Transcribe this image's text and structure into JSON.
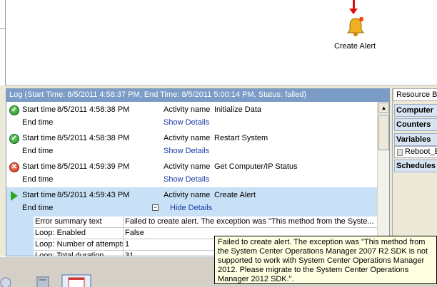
{
  "canvas": {
    "activity_label": "Create Alert",
    "activity_icon": "bell-alert-icon"
  },
  "log": {
    "header": "Log  (Start Time: 8/5/2011 4:58:37 PM, End Time: 8/5/2011 5:00:14 PM, Status: failed)",
    "start_label": "Start time",
    "end_label": "End time",
    "activity_label": "Activity name",
    "entries": [
      {
        "start": "8/5/2011 4:58:38 PM",
        "activity": "Initialize Data",
        "link": "Show Details",
        "status": "success"
      },
      {
        "start": "8/5/2011 4:58:38 PM",
        "activity": "Restart System",
        "link": "Show Details",
        "status": "success"
      },
      {
        "start": "8/5/2011 4:59:39 PM",
        "activity": "Get Computer/IP Status",
        "link": "Show Details",
        "status": "failed"
      },
      {
        "start": "8/5/2011 4:59:43 PM",
        "activity": "Create Alert",
        "link": "Hide Details",
        "status": "running"
      }
    ],
    "details": [
      {
        "key": "Error summary text",
        "value": "Failed to create alert.  The exception was \"This method from the Syste..."
      },
      {
        "key": "Loop: Enabled",
        "value": "False"
      },
      {
        "key": "Loop: Number of attempts",
        "value": "1"
      },
      {
        "key": "Loop: Total duration",
        "value": "31"
      }
    ]
  },
  "tooltip": {
    "text": "Failed to create alert.  The exception was \"This method from the System Center Operations Manager 2007 R2 SDK is not supported to work with System Center Operations Manager 2012. Please migrate to the System Center Operations Manager 2012 SDK.\"."
  },
  "resource_browser": {
    "title": "Resource Br",
    "sections": [
      "Computer",
      "Counters",
      "Variables",
      "Schedules"
    ],
    "variable_item": "Reboot_E"
  },
  "colors": {
    "header_bg": "#7a9cc6",
    "selected_bg": "#c9e1f7",
    "link": "#1a3aa8",
    "tooltip_bg": "#ffffe1"
  }
}
